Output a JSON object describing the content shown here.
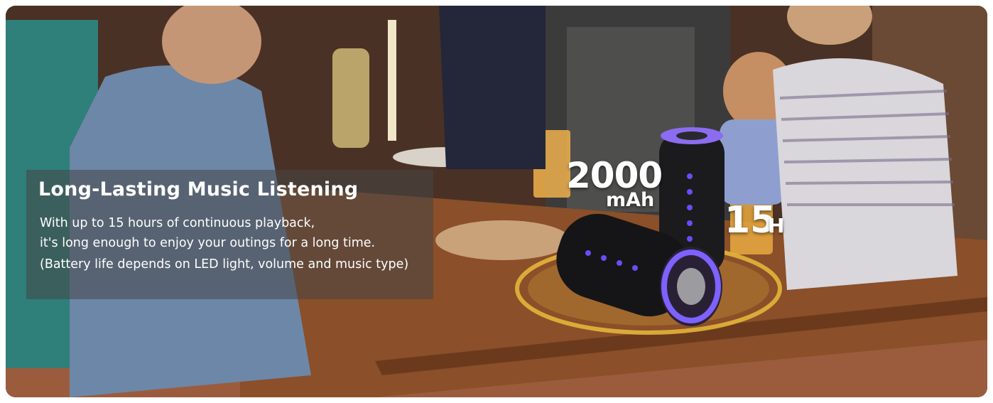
{
  "feature": {
    "title": "Long-Lasting Music Listening",
    "lines": [
      "With up to 15 hours of continuous playback,",
      "it's long enough to enjoy your outings for a long time.",
      "(Battery life depends on LED light, volume and music type)"
    ]
  },
  "capacity": {
    "value": "2000",
    "unit": "mAh"
  },
  "playtime": {
    "value": "15",
    "unit": "H"
  }
}
